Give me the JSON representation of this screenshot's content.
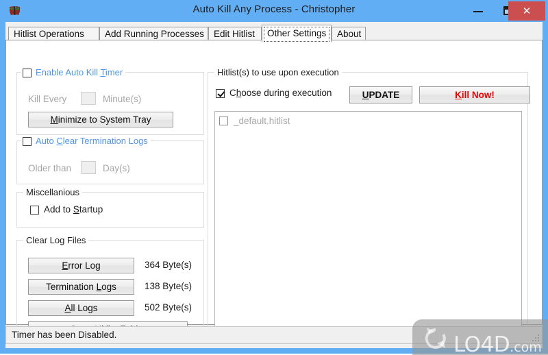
{
  "window": {
    "title": "Auto Kill Any Process - Christopher",
    "icon": "butterfly-icon",
    "minimize_label": "–",
    "maximize_label": "□",
    "close_label": "✕",
    "frame_color": "#62aef5",
    "close_color": "#cb4f4f"
  },
  "tabs": [
    {
      "label": "Hitlist Operations",
      "active": false
    },
    {
      "label": "Add Running Processes",
      "active": false
    },
    {
      "label": "Edit Hitlist",
      "active": false
    },
    {
      "label": "Other Settings",
      "active": true
    },
    {
      "label": "About",
      "active": false
    }
  ],
  "left_panel": {
    "auto_kill_timer": {
      "caption": "Enable Auto Kill Timer",
      "caption_accel": "T",
      "checked": false,
      "caption_color": "#4f96e8",
      "kill_every_label": "Kill Every",
      "kill_every_value": "",
      "minutes_label": "Minute(s)",
      "minimize_button": "Minimize to System Tray",
      "minimize_button_accel": "M"
    },
    "auto_clear_logs": {
      "caption": "Auto Clear Termination Logs",
      "caption_accel": "C",
      "checked": false,
      "caption_color": "#4f96e8",
      "older_than_label": "Older than",
      "older_than_value": "",
      "days_label": "Day(s)"
    },
    "miscellanious": {
      "caption": "Miscellanious",
      "add_to_startup_label": "Add to Startup",
      "add_to_startup_accel": "S",
      "add_to_startup_checked": false
    },
    "clear_log_files": {
      "caption": "Clear Log Files",
      "rows": [
        {
          "button": "Error Log",
          "accel": "E",
          "size": "364 Byte(s)"
        },
        {
          "button": "Termination Logs",
          "accel": "L",
          "size": "138 Byte(s)"
        },
        {
          "button": "All Logs",
          "accel": "A",
          "size": "502 Byte(s)"
        }
      ],
      "open_folder_button": "Open Hitlist Folder",
      "open_folder_accel": "O"
    }
  },
  "right_panel": {
    "caption": "Hitlist(s) to use upon execution",
    "choose_during_execution_label": "Choose during execution",
    "choose_during_execution_accel": "h",
    "choose_during_execution_checked": true,
    "update_button": "UPDATE",
    "update_button_accel": "U",
    "kill_now_button": "Kill Now!",
    "kill_now_accel": "K",
    "kill_now_color": "#f20000",
    "hitlists": [
      {
        "name": "_default.hitlist",
        "checked": false
      }
    ]
  },
  "statusbar": {
    "text": "Timer has been Disabled."
  },
  "watermark": {
    "text": "LO4D",
    "tld": ".com"
  }
}
